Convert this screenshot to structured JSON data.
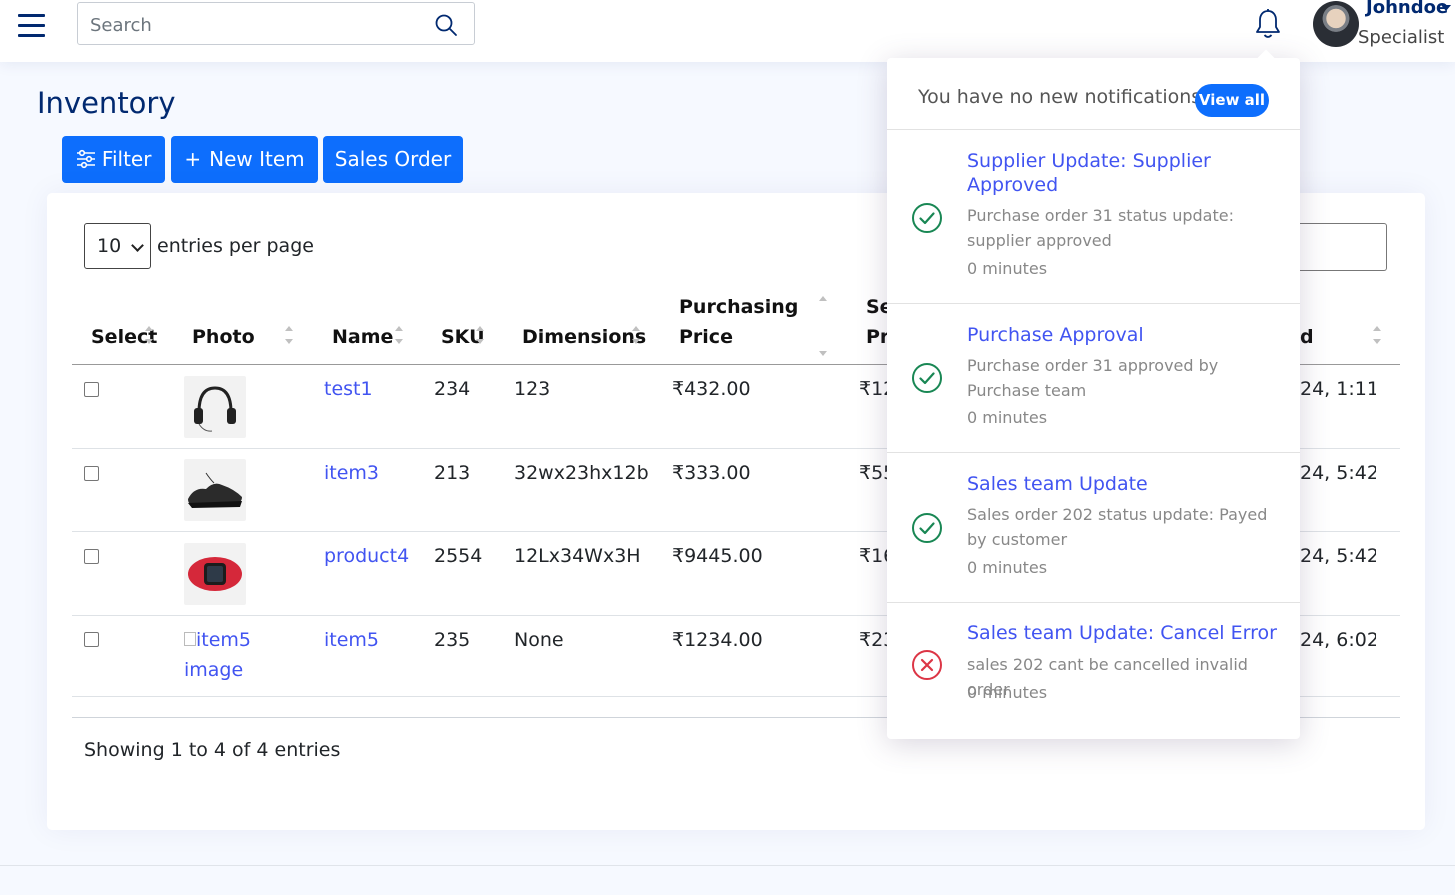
{
  "header": {
    "search_placeholder": "Search",
    "user_name": "Johndoe",
    "user_role": "Specialist"
  },
  "page": {
    "title": "Inventory",
    "buttons": {
      "filter": "Filter",
      "new_item": "New Item",
      "sales_order": "Sales Order"
    }
  },
  "table": {
    "per_page_value": "10",
    "per_page_label": "entries per page",
    "columns": {
      "select": "Select",
      "photo": "Photo",
      "name": "Name",
      "sku": "SKU",
      "dimensions": "Dimensions",
      "purchasing_line1": "Purchasing",
      "purchasing_line2": "Price",
      "selling_line1": "Se",
      "selling_line2": "Pr",
      "date_partial": "d"
    },
    "rows": [
      {
        "name": "test1",
        "sku": "234",
        "dimensions": "123",
        "purchasing_price": "₹432.00",
        "selling_partial": "₹12",
        "date_partial": "24, 1:11"
      },
      {
        "name": "item3",
        "sku": "213",
        "dimensions": "32wx23hx12b",
        "purchasing_price": "₹333.00",
        "selling_partial": "₹55",
        "date_partial": "24, 5:42"
      },
      {
        "name": "product4",
        "sku": "2554",
        "dimensions": "12Lx34Wx3H",
        "purchasing_price": "₹9445.00",
        "selling_partial": "₹16",
        "date_partial": "24, 5:42"
      },
      {
        "name": "item5",
        "sku": "235",
        "dimensions": "None",
        "purchasing_price": "₹1234.00",
        "selling_partial": "₹23",
        "date_partial": "24, 6:02",
        "photo_alt_line1": "item5",
        "photo_alt_line2": "image"
      }
    ],
    "footer": "Showing 1 to 4 of 4 entries"
  },
  "notifications": {
    "header": "You have no new notifications",
    "view_all": "View all",
    "items": [
      {
        "title": "Supplier Update: Supplier Approved",
        "message": "Purchase order 31 status update: supplier approved",
        "time": "0 minutes",
        "status": "success"
      },
      {
        "title": "Purchase Approval",
        "message": "Purchase order 31 approved by Purchase team",
        "time": "0 minutes",
        "status": "success"
      },
      {
        "title": "Sales team Update",
        "message": "Sales order 202 status update: Payed by customer",
        "time": "0 minutes",
        "status": "success"
      },
      {
        "title": "Sales team Update: Cancel Error",
        "message": "sales 202 cant be cancelled invalid order",
        "time": "0 minutes",
        "status": "error"
      }
    ]
  },
  "colors": {
    "primary": "#0d6efd",
    "link": "#4154f1",
    "heading": "#012970",
    "success": "#198754",
    "danger": "#dc3545"
  }
}
